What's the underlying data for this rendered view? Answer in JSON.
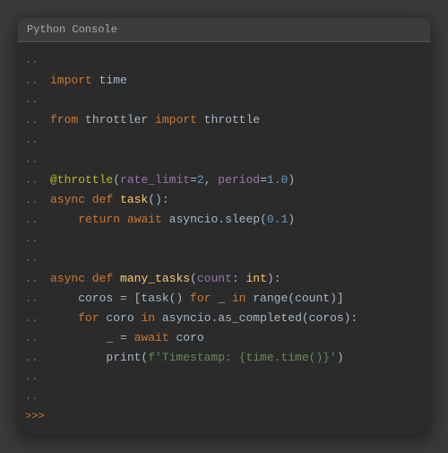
{
  "window": {
    "title": "Python Console"
  },
  "lines": [
    {
      "prompt": "..",
      "content": ""
    },
    {
      "prompt": "..",
      "content": "import time",
      "type": "import"
    },
    {
      "prompt": "..",
      "content": ""
    },
    {
      "prompt": "..",
      "content": "from throttler import throttle",
      "type": "from_import"
    },
    {
      "prompt": "..",
      "content": ""
    },
    {
      "prompt": "..",
      "content": ""
    },
    {
      "prompt": "..",
      "content": "@throttle(rate_limit=2, period=1.0)",
      "type": "decorator"
    },
    {
      "prompt": "..",
      "content": "async def task():",
      "type": "async_def"
    },
    {
      "prompt": "..",
      "content": "    return await asyncio.sleep(0.1)",
      "type": "return"
    },
    {
      "prompt": "..",
      "content": ""
    },
    {
      "prompt": "..",
      "content": ""
    },
    {
      "prompt": "..",
      "content": "async def many_tasks(count: int):",
      "type": "async_def2"
    },
    {
      "prompt": "..",
      "content": "    coros = [task() for _ in range(count)]",
      "type": "list_comp"
    },
    {
      "prompt": "..",
      "content": "    for coro in asyncio.as_completed(coros):",
      "type": "for_loop"
    },
    {
      "prompt": "..",
      "content": "        _ = await coro",
      "type": "await"
    },
    {
      "prompt": "..",
      "content": "        print(f'Timestamp: {time.time()}')",
      "type": "print"
    },
    {
      "prompt": "..",
      "content": ""
    },
    {
      "prompt": "..",
      "content": ""
    }
  ],
  "cursor": {
    "prompt": ">>>"
  }
}
